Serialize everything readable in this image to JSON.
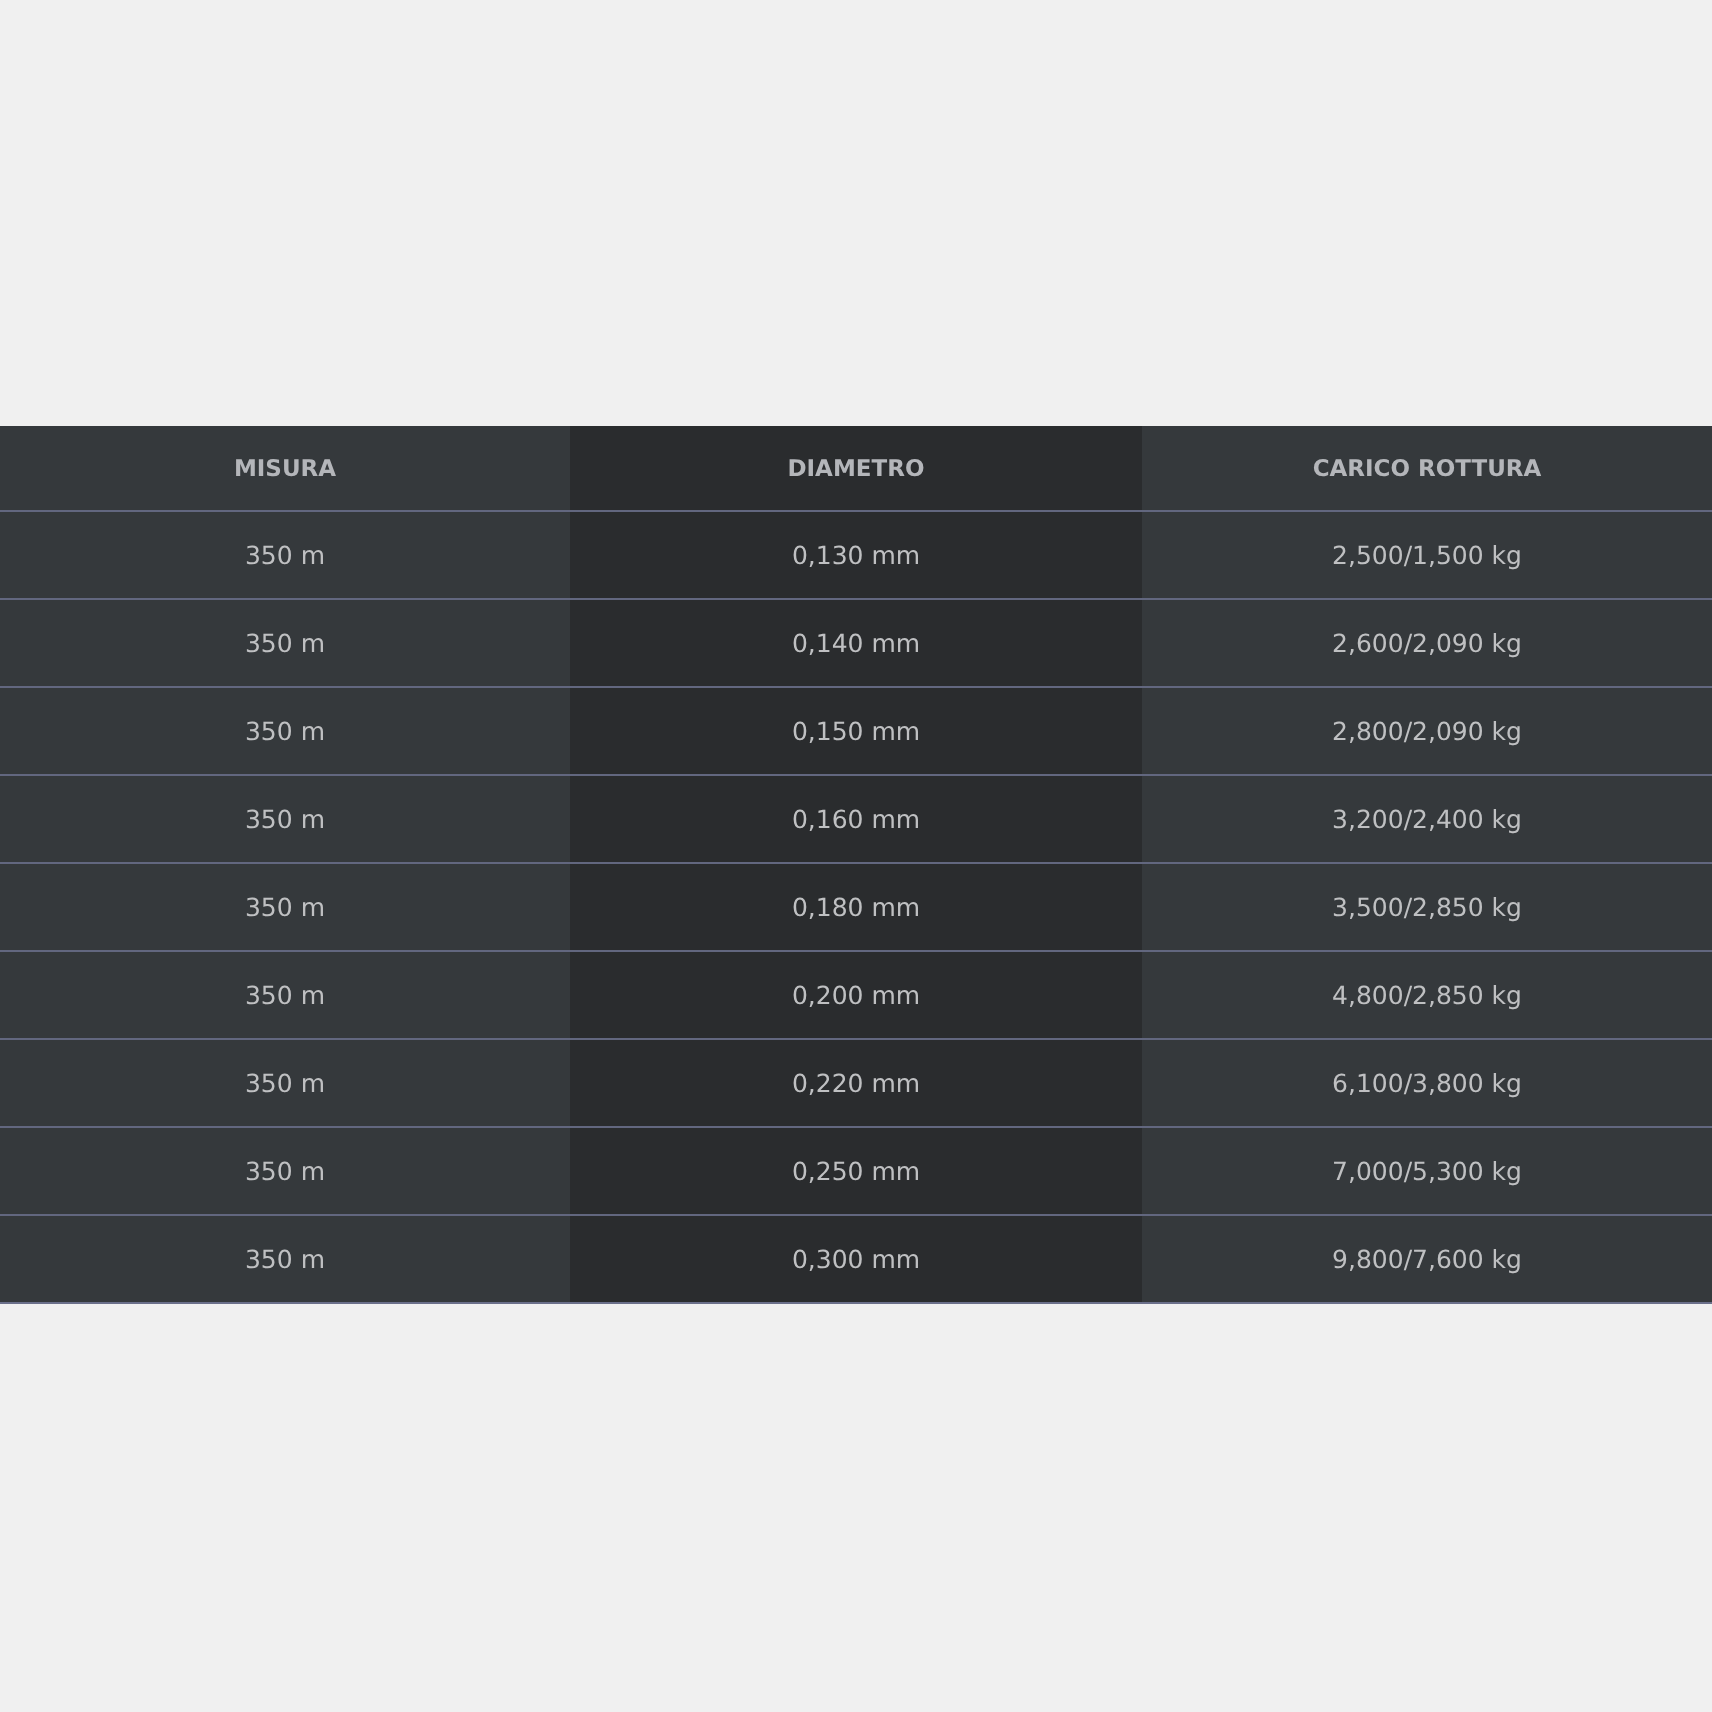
{
  "table": {
    "columns": [
      "MISURA",
      "DIAMETRO",
      "CARICO ROTTURA"
    ],
    "rows": [
      [
        "350 m",
        "0,130 mm",
        "2,500/1,500 kg"
      ],
      [
        "350 m",
        "0,140 mm",
        "2,600/2,090 kg"
      ],
      [
        "350 m",
        "0,150 mm",
        "2,800/2,090 kg"
      ],
      [
        "350 m",
        "0,160 mm",
        "3,200/2,400 kg"
      ],
      [
        "350 m",
        "0,180 mm",
        "3,500/2,850 kg"
      ],
      [
        "350 m",
        "0,200 mm",
        "4,800/2,850 kg"
      ],
      [
        "350 m",
        "0,220 mm",
        "6,100/3,800 kg"
      ],
      [
        "350 m",
        "0,250 mm",
        "7,000/5,300 kg"
      ],
      [
        "350 m",
        "0,300 mm",
        "9,800/7,600 kg"
      ]
    ]
  }
}
